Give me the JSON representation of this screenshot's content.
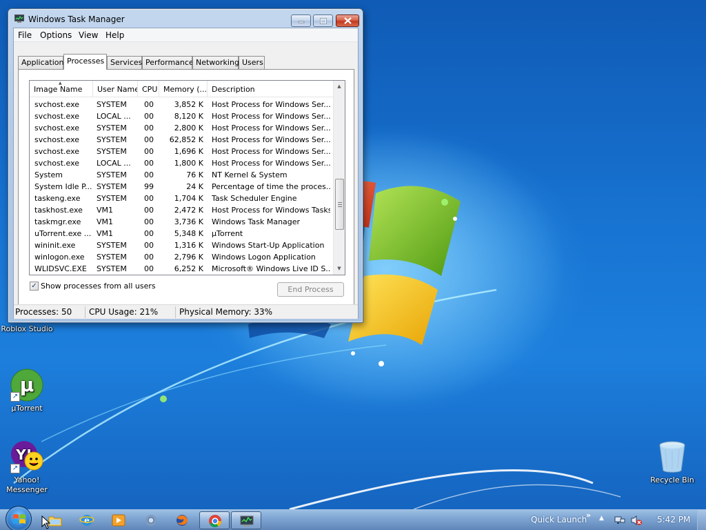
{
  "window": {
    "title": "Windows Task Manager",
    "menu": [
      "File",
      "Options",
      "View",
      "Help"
    ],
    "tabs": [
      "Applications",
      "Processes",
      "Services",
      "Performance",
      "Networking",
      "Users"
    ],
    "active_tab": "Processes"
  },
  "process_list": {
    "columns": [
      "Image Name",
      "User Name",
      "CPU",
      "Memory (...",
      "Description"
    ],
    "rows": [
      {
        "name": "svchost.exe",
        "user": "SYSTEM",
        "cpu": "00",
        "memory": "3,852 K",
        "description": "Host Process for Windows Ser..."
      },
      {
        "name": "svchost.exe",
        "user": "LOCAL ...",
        "cpu": "00",
        "memory": "8,120 K",
        "description": "Host Process for Windows Ser..."
      },
      {
        "name": "svchost.exe",
        "user": "SYSTEM",
        "cpu": "00",
        "memory": "2,800 K",
        "description": "Host Process for Windows Ser..."
      },
      {
        "name": "svchost.exe",
        "user": "SYSTEM",
        "cpu": "00",
        "memory": "62,852 K",
        "description": "Host Process for Windows Ser..."
      },
      {
        "name": "svchost.exe",
        "user": "SYSTEM",
        "cpu": "00",
        "memory": "1,696 K",
        "description": "Host Process for Windows Ser..."
      },
      {
        "name": "svchost.exe",
        "user": "LOCAL ...",
        "cpu": "00",
        "memory": "1,800 K",
        "description": "Host Process for Windows Ser..."
      },
      {
        "name": "System",
        "user": "SYSTEM",
        "cpu": "00",
        "memory": "76 K",
        "description": "NT Kernel & System"
      },
      {
        "name": "System Idle P...",
        "user": "SYSTEM",
        "cpu": "99",
        "memory": "24 K",
        "description": "Percentage of time the proces..."
      },
      {
        "name": "taskeng.exe",
        "user": "SYSTEM",
        "cpu": "00",
        "memory": "1,704 K",
        "description": "Task Scheduler Engine"
      },
      {
        "name": "taskhost.exe",
        "user": "VM1",
        "cpu": "00",
        "memory": "2,472 K",
        "description": "Host Process for Windows Tasks"
      },
      {
        "name": "taskmgr.exe",
        "user": "VM1",
        "cpu": "00",
        "memory": "3,736 K",
        "description": "Windows Task Manager"
      },
      {
        "name": "uTorrent.exe ...",
        "user": "VM1",
        "cpu": "00",
        "memory": "5,348 K",
        "description": "µTorrent"
      },
      {
        "name": "wininit.exe",
        "user": "SYSTEM",
        "cpu": "00",
        "memory": "1,316 K",
        "description": "Windows Start-Up Application"
      },
      {
        "name": "winlogon.exe",
        "user": "SYSTEM",
        "cpu": "00",
        "memory": "2,796 K",
        "description": "Windows Logon Application"
      },
      {
        "name": "WLIDSVC.EXE",
        "user": "SYSTEM",
        "cpu": "00",
        "memory": "6,252 K",
        "description": "Microsoft® Windows Live ID S..."
      }
    ],
    "scroll_position": 0.72
  },
  "options": {
    "show_all_users_label": "Show processes from all users",
    "show_all_users_checked": true,
    "end_process_label": "End Process"
  },
  "status": {
    "processes": "Processes: 50",
    "cpu_usage": "CPU Usage: 21%",
    "physical_memory": "Physical Memory: 33%"
  },
  "desktop_icons": [
    {
      "label": "Roblox Studio",
      "icon": "roblox-studio-icon"
    },
    {
      "label": "µTorrent",
      "icon": "utorrent-icon"
    },
    {
      "label": "Yahoo! Messenger",
      "icon": "yahoo-messenger-icon"
    },
    {
      "label": "Recycle Bin",
      "icon": "recycle-bin-icon"
    }
  ],
  "taskbar": {
    "pinned": [
      "explorer-icon",
      "internet-explorer-icon",
      "media-player-icon",
      "chrome-alt-icon",
      "firefox-icon",
      "chrome-icon",
      "task-manager-icon"
    ],
    "quick_launch": "Quick Launch",
    "clock": "5:42 PM"
  },
  "colors": {
    "desktop_blue": "#1874d2",
    "win7_red": "#e8502f",
    "win7_green": "#7cc224",
    "win7_yellow": "#f5c60f"
  }
}
